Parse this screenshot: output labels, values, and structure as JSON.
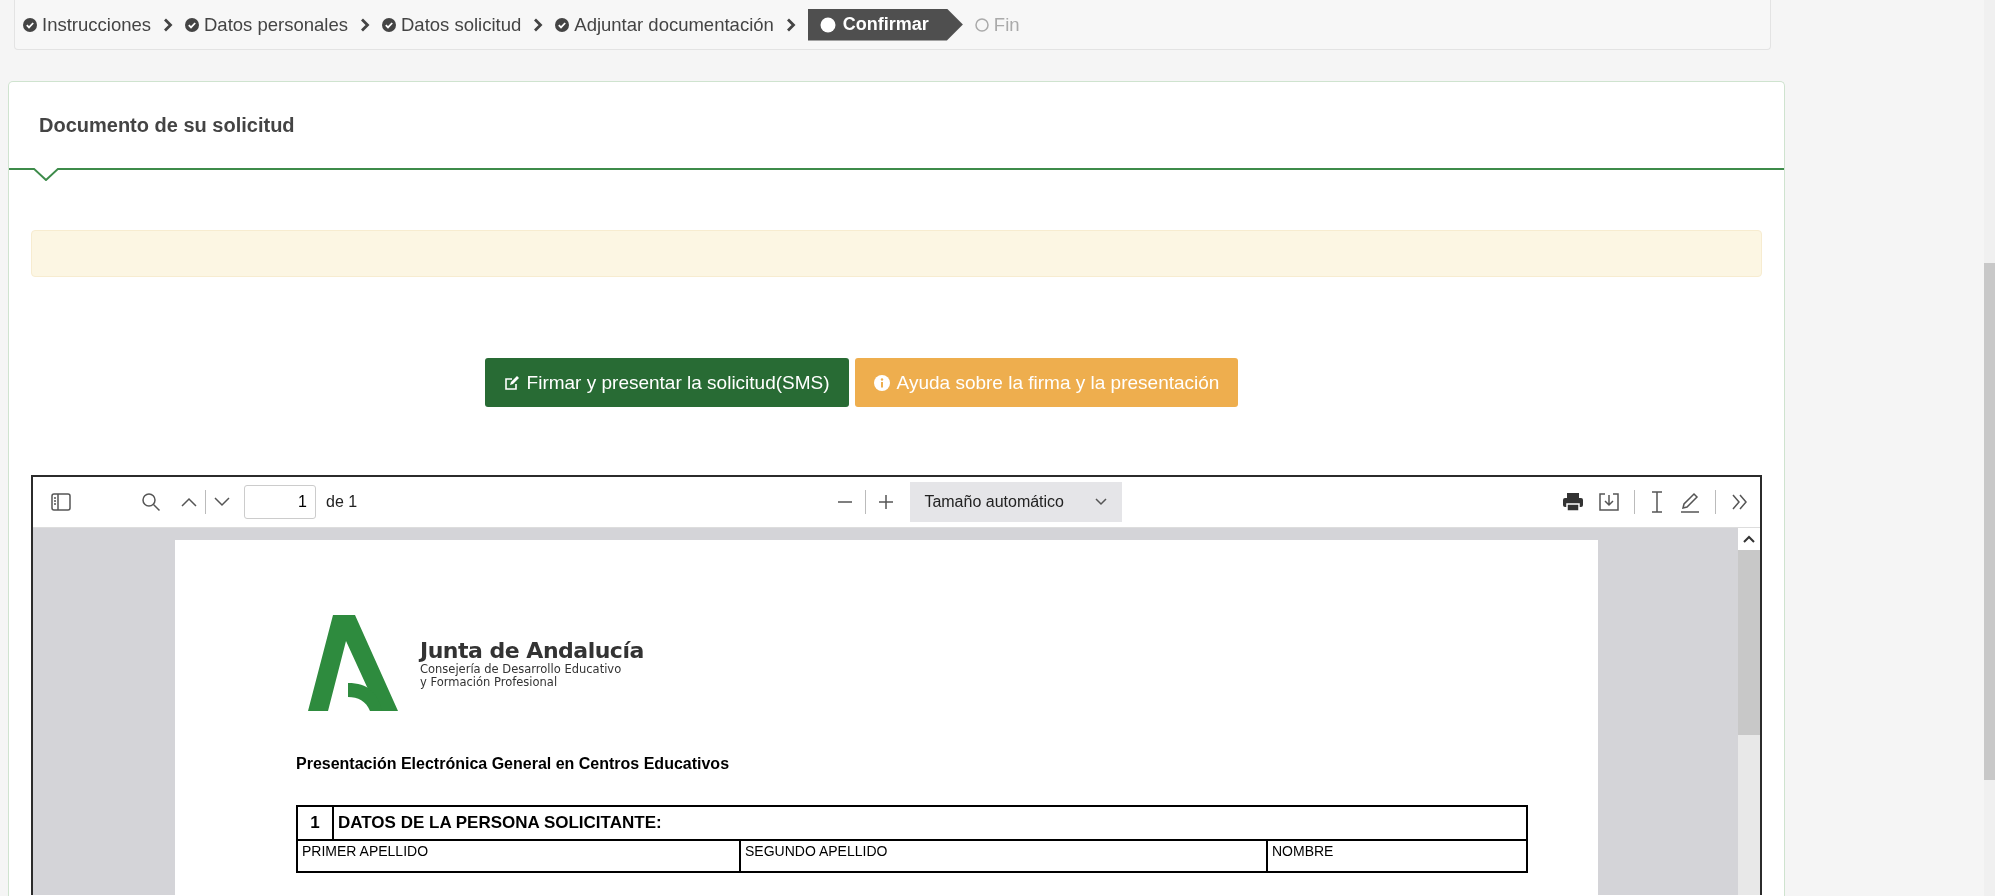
{
  "steps": [
    {
      "label": "Instrucciones",
      "completed": true,
      "selected": false
    },
    {
      "label": "Datos personales",
      "completed": true,
      "selected": false
    },
    {
      "label": "Datos solicitud",
      "completed": true,
      "selected": false
    },
    {
      "label": "Adjuntar documentación",
      "completed": true,
      "selected": false
    },
    {
      "label": "Confirmar",
      "completed": false,
      "selected": true
    },
    {
      "label": "Fin",
      "completed": false,
      "selected": false
    }
  ],
  "panel": {
    "title": "Documento de su solicitud"
  },
  "buttons": [
    {
      "label": "Firmar y presentar la solicitud(SMS)",
      "kind": "sign"
    },
    {
      "label": "Ayuda sobre la firma y la presentación",
      "kind": "help"
    }
  ],
  "pdf_viewer": {
    "page_number": "1",
    "page_count": "de 1",
    "zoom": "Tamaño automático",
    "document": {
      "org_name": "Junta de Andalucía",
      "org_subtitle": [
        "Consejería de Desarrollo Educativo",
        "y Formación Profesional"
      ],
      "title": "Presentación Electrónica General en Centros Educativos",
      "section": {
        "number": "1",
        "title": "DATOS DE LA PERSONA SOLICITANTE:",
        "fields": [
          "PRIMER APELLIDO",
          "SEGUNDO APELLIDO",
          "NOMBRE"
        ]
      }
    }
  }
}
